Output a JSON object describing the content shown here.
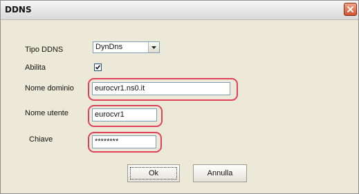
{
  "window": {
    "title": "DDNS"
  },
  "form": {
    "tipo_ddns": {
      "label": "Tipo DDNS",
      "value": "DynDns"
    },
    "abilita": {
      "label": "Abilita",
      "checked": true
    },
    "nome_dominio": {
      "label": "Nome dominio",
      "value": "eurocvr1.ns0.it"
    },
    "nome_utente": {
      "label": "Nome utente",
      "value": "eurocvr1"
    },
    "chiave": {
      "label": "Chiave",
      "value": "********"
    }
  },
  "buttons": {
    "ok": "Ok",
    "annulla": "Annulla"
  },
  "colors": {
    "highlight": "#e0415a",
    "close": "#d2522e"
  }
}
